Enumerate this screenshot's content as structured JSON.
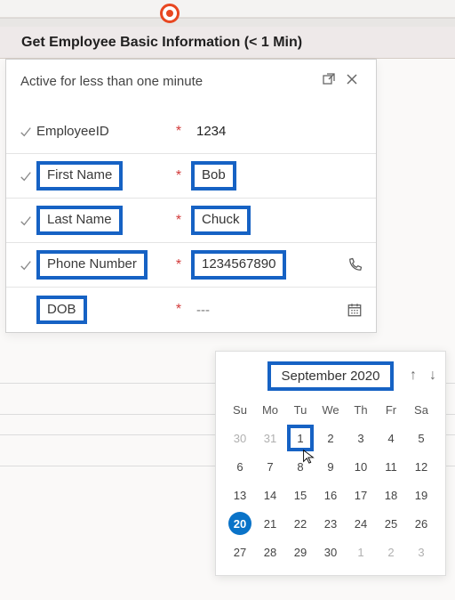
{
  "header": {
    "title": "Get Employee Basic Information  (< 1 Min)"
  },
  "panel": {
    "title": "Active for less than one minute"
  },
  "fields": {
    "employee_id": {
      "label": "EmployeeID",
      "value": "1234",
      "required": "*"
    },
    "first_name": {
      "label": "First Name",
      "value": "Bob",
      "required": "*"
    },
    "last_name": {
      "label": "Last Name",
      "value": "Chuck",
      "required": "*"
    },
    "phone": {
      "label": "Phone Number",
      "value": "1234567890",
      "required": "*"
    },
    "dob": {
      "label": "DOB",
      "value": "---",
      "required": "*"
    }
  },
  "calendar": {
    "month_label": "September 2020",
    "dow": {
      "d0": "Su",
      "d1": "Mo",
      "d2": "Tu",
      "d3": "We",
      "d4": "Th",
      "d5": "Fr",
      "d6": "Sa"
    },
    "days": {
      "r0c0": "30",
      "r0c1": "31",
      "r0c2": "1",
      "r0c3": "2",
      "r0c4": "3",
      "r0c5": "4",
      "r0c6": "5",
      "r1c0": "6",
      "r1c1": "7",
      "r1c2": "8",
      "r1c3": "9",
      "r1c4": "10",
      "r1c5": "11",
      "r1c6": "12",
      "r2c0": "13",
      "r2c1": "14",
      "r2c2": "15",
      "r2c3": "16",
      "r2c4": "17",
      "r2c5": "18",
      "r2c6": "19",
      "r3c0": "20",
      "r3c1": "21",
      "r3c2": "22",
      "r3c3": "23",
      "r3c4": "24",
      "r3c5": "25",
      "r3c6": "26",
      "r4c0": "27",
      "r4c1": "28",
      "r4c2": "29",
      "r4c3": "30",
      "r4c4": "1",
      "r4c5": "2",
      "r4c6": "3"
    },
    "today_key": "r3c0",
    "selected_key": "r0c2"
  }
}
